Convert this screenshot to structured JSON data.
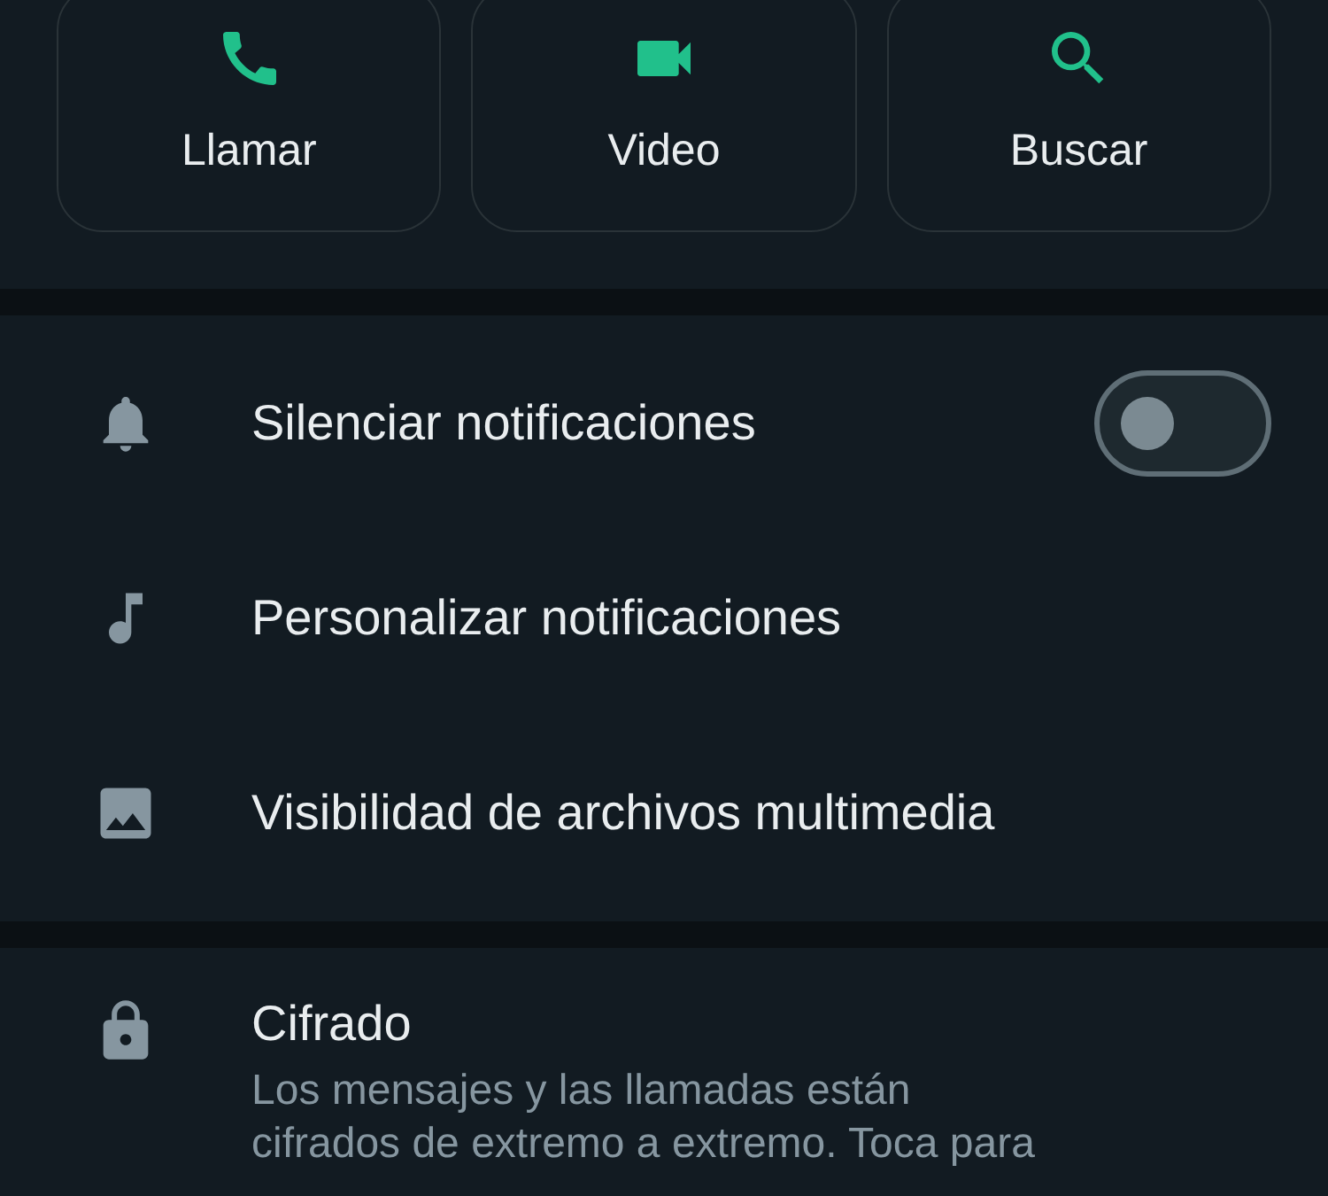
{
  "actions": [
    {
      "kind": "call",
      "label": "Llamar"
    },
    {
      "kind": "video",
      "label": "Video"
    },
    {
      "kind": "search",
      "label": "Buscar"
    }
  ],
  "settings": [
    {
      "kind": "mute",
      "label": "Silenciar notificaciones",
      "toggle": {
        "on": false
      }
    },
    {
      "kind": "tone",
      "label": "Personalizar notificaciones"
    },
    {
      "kind": "media",
      "label": "Visibilidad de archivos multimedia"
    }
  ],
  "security": [
    {
      "kind": "lock",
      "label": "Cifrado",
      "description": "Los mensajes y las llamadas están\ncifrados de extremo a extremo. Toca para"
    }
  ]
}
